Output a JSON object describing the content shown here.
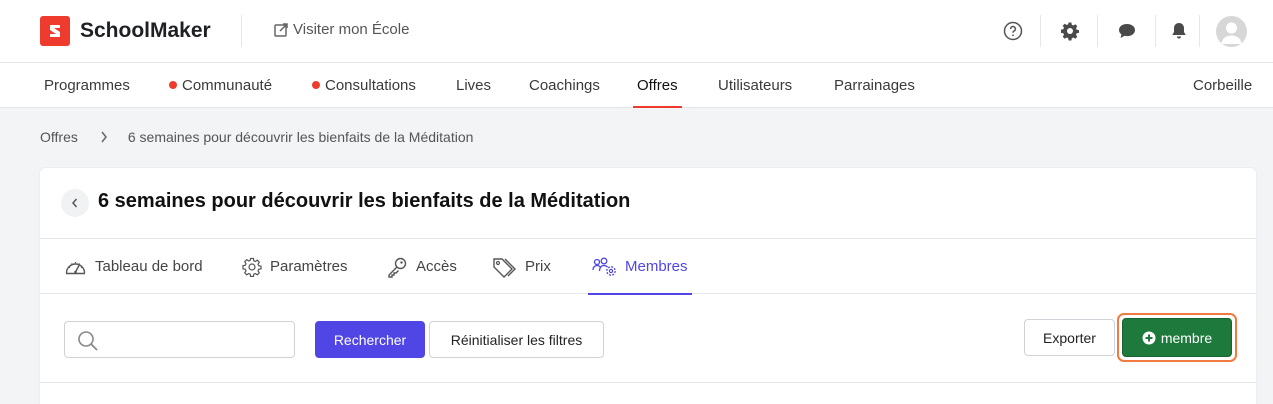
{
  "header": {
    "brand": "SchoolMaker",
    "visit_label": "Visiter mon École",
    "icons": [
      "help-circle-icon",
      "gear-icon",
      "chat-bubble-icon",
      "bell-icon",
      "user-avatar"
    ]
  },
  "nav": {
    "items": [
      {
        "label": "Programmes",
        "dot": false
      },
      {
        "label": "Communauté",
        "dot": true
      },
      {
        "label": "Consultations",
        "dot": true
      },
      {
        "label": "Lives",
        "dot": false
      },
      {
        "label": "Coachings",
        "dot": false
      },
      {
        "label": "Offres",
        "dot": false,
        "active": true
      },
      {
        "label": "Utilisateurs",
        "dot": false
      },
      {
        "label": "Parrainages",
        "dot": false
      }
    ],
    "trash": "Corbeille"
  },
  "breadcrumb": {
    "root": "Offres",
    "current": "6 semaines pour découvrir les bienfaits de la Méditation"
  },
  "page": {
    "title": "6 semaines pour découvrir les bienfaits de la Méditation",
    "tabs": [
      {
        "label": "Tableau de bord",
        "icon": "dashboard-gauge-icon"
      },
      {
        "label": "Paramètres",
        "icon": "gear-icon"
      },
      {
        "label": "Accès",
        "icon": "key-icon"
      },
      {
        "label": "Prix",
        "icon": "price-tag-icon"
      },
      {
        "label": "Membres",
        "icon": "members-gear-icon",
        "active": true
      }
    ]
  },
  "toolbar": {
    "search_placeholder": "",
    "search_label": "Rechercher",
    "reset_label": "Réinitialiser les filtres",
    "export_label": "Exporter",
    "add_member_label": "membre"
  },
  "colors": {
    "brand_red": "#ef3b2d",
    "accent_purple": "#5046e5",
    "add_green": "#1d7a3c",
    "highlight_orange": "#f07a3f"
  }
}
